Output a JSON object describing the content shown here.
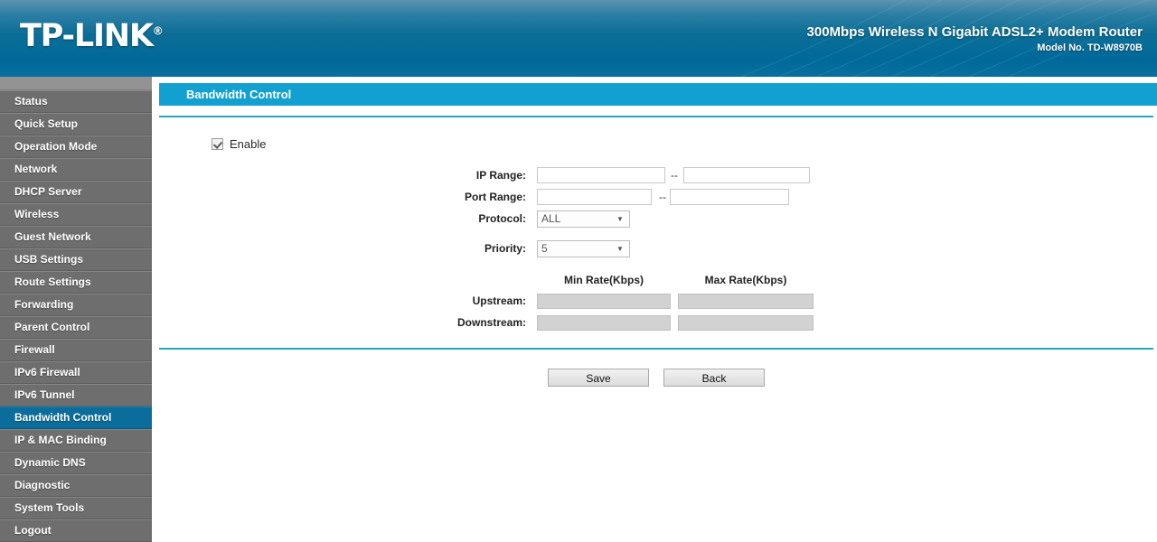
{
  "header": {
    "brand": "TP-LINK",
    "brand_mark": "®",
    "product_title": "300Mbps Wireless N Gigabit ADSL2+ Modem Router",
    "model_label": "Model No. TD-W8970B",
    "accent_color": "#0b6e97"
  },
  "sidebar": {
    "active_index": 14,
    "active_color": "#0a6d9c",
    "background_color": "#6e6e6e",
    "items": [
      {
        "label": "Status"
      },
      {
        "label": "Quick Setup"
      },
      {
        "label": "Operation Mode"
      },
      {
        "label": "Network"
      },
      {
        "label": "DHCP Server"
      },
      {
        "label": "Wireless"
      },
      {
        "label": "Guest Network"
      },
      {
        "label": "USB Settings"
      },
      {
        "label": "Route Settings"
      },
      {
        "label": "Forwarding"
      },
      {
        "label": "Parent Control"
      },
      {
        "label": "Firewall"
      },
      {
        "label": "IPv6 Firewall"
      },
      {
        "label": "IPv6 Tunnel"
      },
      {
        "label": "Bandwidth Control"
      },
      {
        "label": "IP & MAC Binding"
      },
      {
        "label": "Dynamic DNS"
      },
      {
        "label": "Diagnostic"
      },
      {
        "label": "System Tools"
      },
      {
        "label": "Logout"
      }
    ]
  },
  "main": {
    "page_title": "Bandwidth Control",
    "title_bar_color": "#12a0d0",
    "divider_color": "#2aa8b8",
    "enable": {
      "label": "Enable",
      "checked": true
    },
    "fields": {
      "ip_range_label": "IP Range:",
      "ip_range_start": "",
      "ip_range_start_placeholder": "",
      "ip_range_end": "",
      "ip_range_end_placeholder": "",
      "port_range_label": "Port Range:",
      "port_range_start": "",
      "port_range_start_placeholder": "",
      "port_range_end": "",
      "port_range_end_placeholder": "",
      "range_separator": "--",
      "protocol_label": "Protocol:",
      "protocol_value": "ALL",
      "priority_label": "Priority:",
      "priority_value": "5",
      "dropdown_arrow": "▼"
    },
    "rate_table": {
      "min_rate_header": "Min Rate(Kbps)",
      "max_rate_header": "Max Rate(Kbps)",
      "upstream_label": "Upstream:",
      "upstream_min": "",
      "upstream_max": "",
      "downstream_label": "Downstream:",
      "downstream_min": "",
      "downstream_max": ""
    },
    "buttons": {
      "save_label": "Save",
      "back_label": "Back"
    }
  }
}
